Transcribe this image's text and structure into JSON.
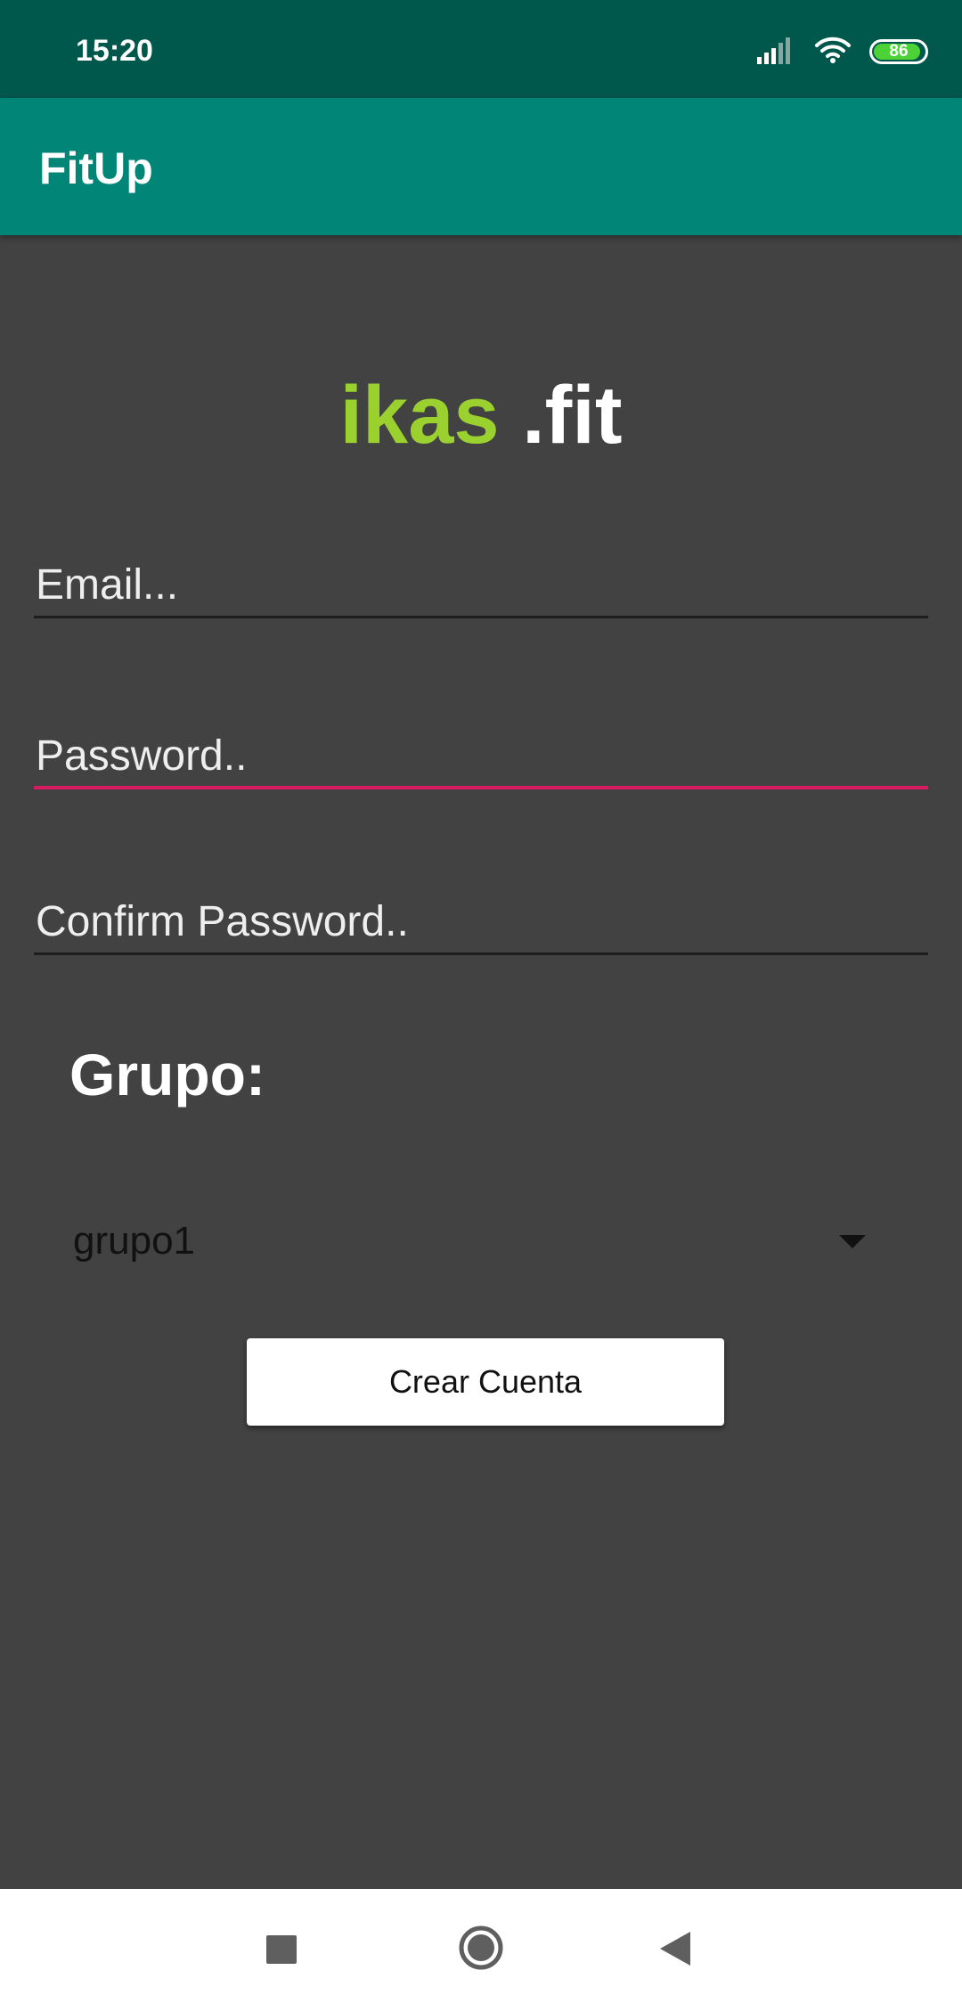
{
  "status_bar": {
    "time": "15:20",
    "battery_level": "86",
    "icons": [
      "signal-icon",
      "wifi-icon",
      "battery-icon"
    ]
  },
  "app_bar": {
    "title": "FitUp"
  },
  "logo": {
    "part1": "ikas",
    "part2": ".fit",
    "part1_color": "#9bd12f",
    "part2_color": "#ffffff"
  },
  "form": {
    "email_placeholder": "Email...",
    "password_placeholder": "Password..",
    "confirm_placeholder": "Confirm Password..",
    "group_label": "Grupo:",
    "group_selected": "grupo1",
    "submit_label": "Crear Cuenta"
  },
  "nav_bar": {
    "icons": [
      "recents-icon",
      "home-icon",
      "back-icon"
    ]
  },
  "colors": {
    "status_bar": "#00574b",
    "app_bar": "#008577",
    "background": "#424242",
    "focus_accent": "#d81b60"
  }
}
